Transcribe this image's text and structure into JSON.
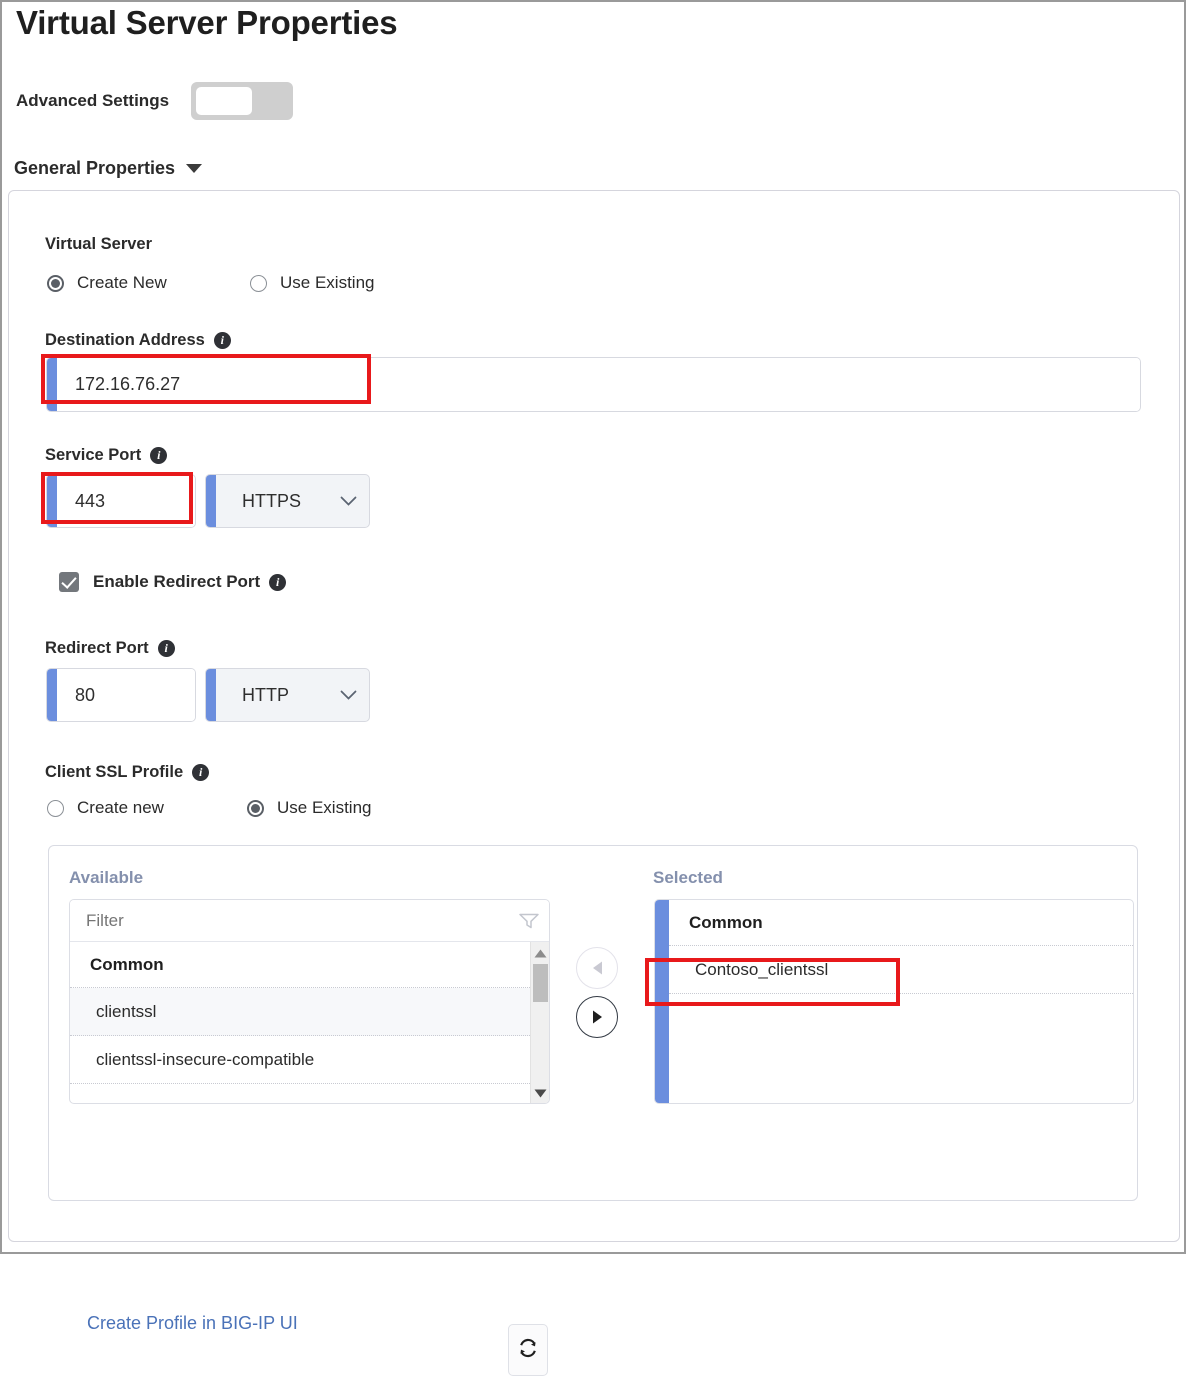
{
  "page": {
    "title": "Virtual Server Properties"
  },
  "advanced": {
    "label": "Advanced Settings",
    "state": "off"
  },
  "general_section": {
    "label": "General Properties",
    "expanded": true
  },
  "virtual_server": {
    "label": "Virtual Server",
    "options": [
      {
        "label": "Create New",
        "selected": true
      },
      {
        "label": "Use Existing",
        "selected": false
      }
    ]
  },
  "destination_address": {
    "label": "Destination Address",
    "value": "172.16.76.27",
    "has_info": true,
    "accent_color": "#6b8ede",
    "highlighted": true
  },
  "service_port": {
    "label": "Service Port",
    "value": "443",
    "protocol": "HTTPS",
    "has_info": true,
    "highlighted": true
  },
  "enable_redirect_port": {
    "label": "Enable Redirect Port",
    "checked": true,
    "has_info": true
  },
  "redirect_port": {
    "label": "Redirect Port",
    "value": "80",
    "protocol": "HTTP",
    "has_info": true
  },
  "client_ssl_profile": {
    "label": "Client SSL Profile",
    "has_info": true,
    "options": [
      {
        "label": "Create new",
        "selected": false
      },
      {
        "label": "Use Existing",
        "selected": true
      }
    ]
  },
  "dual_list": {
    "available": {
      "title": "Available",
      "filter_placeholder": "Filter",
      "filter_value": "",
      "group": "Common",
      "items": [
        {
          "label": "clientssl",
          "highlighted": true
        },
        {
          "label": "clientssl-insecure-compatible",
          "highlighted": false
        }
      ]
    },
    "selected": {
      "title": "Selected",
      "group": "Common",
      "items": [
        {
          "label": "Contoso_clientssl",
          "highlighted": true
        }
      ]
    },
    "transfer": {
      "move_left_label": "◀",
      "move_left_enabled": false,
      "move_right_label": "▶",
      "move_right_enabled": true
    },
    "create_profile_link": "Create Profile in BIG-IP UI",
    "refresh_label": "refresh"
  },
  "icons": {
    "info": "i",
    "filter": "filter-icon",
    "chevron_down": "chevron-down-icon",
    "refresh": "refresh-icon",
    "scroll_up": "scroll-up-arrow",
    "scroll_down": "scroll-down-arrow"
  },
  "colors": {
    "accent_blue": "#6b8ede",
    "link_blue": "#4a72b8",
    "annotation_red": "#e8191b",
    "column_title": "#8490ad",
    "toggle_track": "#cfcfcf"
  }
}
